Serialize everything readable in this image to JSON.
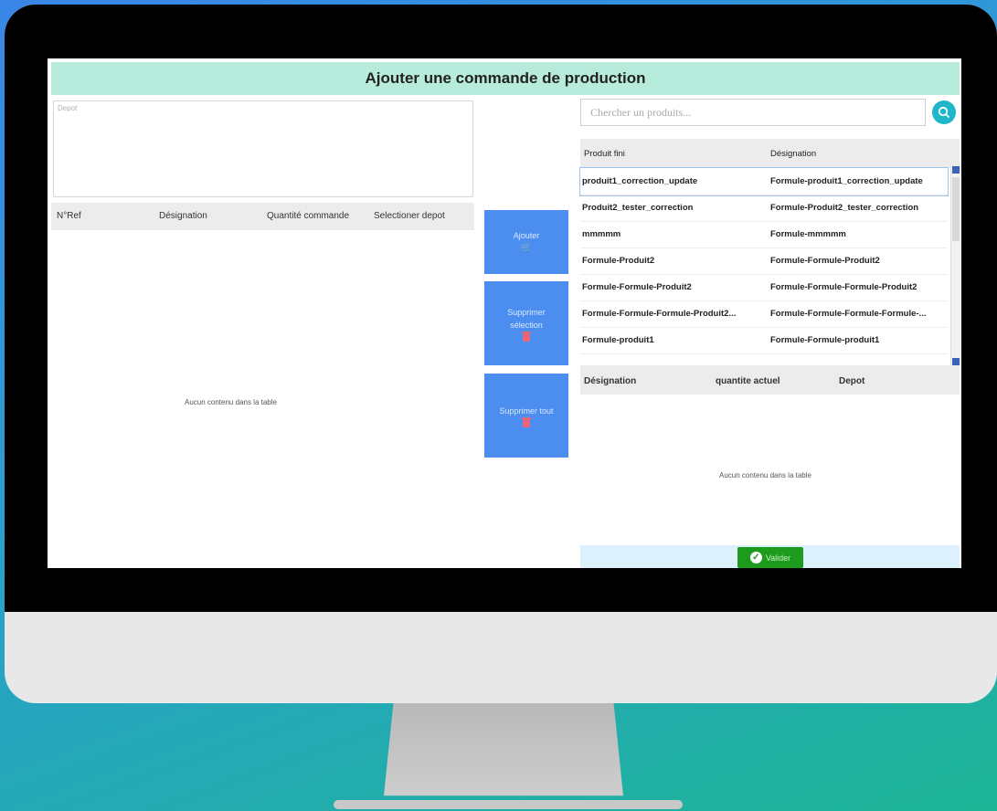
{
  "page": {
    "title": "Ajouter une commande de production",
    "depot_placeholder": "Depot"
  },
  "order_table": {
    "columns": [
      "N°Ref",
      "Désignation",
      "Quantité commande",
      "Selectioner depot"
    ],
    "empty_message": "Aucun contenu dans la table"
  },
  "actions": {
    "add_label": "Ajouter",
    "remove_selection_label": "Supprimer sélection",
    "remove_all_label": "Supprimer tout"
  },
  "search": {
    "placeholder": "Chercher un produits..."
  },
  "products_table": {
    "columns": [
      "Produit fini",
      "Désignation"
    ],
    "rows": [
      {
        "product": "produit1_correction_update",
        "designation": "Formule-produit1_correction_update"
      },
      {
        "product": "Produit2_tester_correction",
        "designation": "Formule-Produit2_tester_correction"
      },
      {
        "product": "mmmmm",
        "designation": "Formule-mmmmm"
      },
      {
        "product": "Formule-Produit2",
        "designation": "Formule-Formule-Produit2"
      },
      {
        "product": "Formule-Formule-Produit2",
        "designation": "Formule-Formule-Formule-Produit2"
      },
      {
        "product": "Formule-Formule-Formule-Produit2...",
        "designation": "Formule-Formule-Formule-Formule-..."
      },
      {
        "product": "Formule-produit1",
        "designation": "Formule-Formule-produit1"
      }
    ]
  },
  "stock_table": {
    "columns": [
      "Désignation",
      "quantite actuel",
      "Depot"
    ],
    "empty_message": "Aucun contenu dans la table"
  },
  "footer": {
    "validate_label": "Valider"
  },
  "colors": {
    "header_bg": "#b7ecdd",
    "action_button": "#4b8ef0",
    "validate_button": "#1c9b1c",
    "search_button": "#1fb6c9"
  }
}
